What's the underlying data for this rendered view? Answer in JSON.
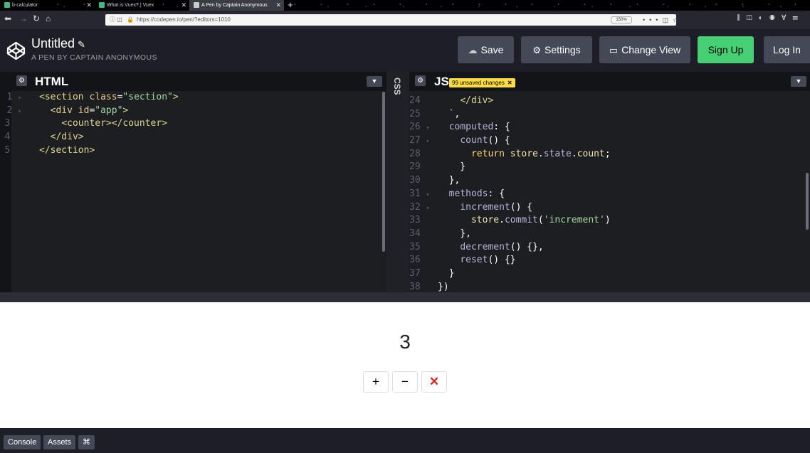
{
  "browser": {
    "tabs": [
      {
        "title": "b-calculator",
        "active": false,
        "favicon_color": "#41b883"
      },
      {
        "title": "What is Vuex? | Vuex",
        "active": false,
        "favicon_color": "#41b883"
      },
      {
        "title": "A Pen by Captain Anonymous",
        "active": true,
        "favicon_color": "#cccccc"
      }
    ],
    "new_tab": "+",
    "url": "https://codepen.io/pen/?editors=1010",
    "zoom": "150%"
  },
  "header": {
    "title": "Untitled",
    "subtitle": "A PEN BY CAPTAIN ANONYMOUS",
    "buttons": {
      "save": "Save",
      "settings": "Settings",
      "change_view": "Change View",
      "sign_up": "Sign Up",
      "log_in": "Log In"
    }
  },
  "editors": {
    "html": {
      "title": "HTML",
      "lines": [
        {
          "n": "1",
          "fold": true
        },
        {
          "n": "2",
          "fold": true
        },
        {
          "n": "3",
          "fold": false
        },
        {
          "n": "4",
          "fold": false
        },
        {
          "n": "5",
          "fold": false
        }
      ]
    },
    "css": {
      "title": "CSS"
    },
    "js": {
      "title": "JS",
      "badge": "99 unsaved changes",
      "lines": [
        {
          "n": "24",
          "fold": false
        },
        {
          "n": "25",
          "fold": false
        },
        {
          "n": "26",
          "fold": true
        },
        {
          "n": "27",
          "fold": true
        },
        {
          "n": "28",
          "fold": false
        },
        {
          "n": "29",
          "fold": false
        },
        {
          "n": "30",
          "fold": false
        },
        {
          "n": "31",
          "fold": true
        },
        {
          "n": "32",
          "fold": true
        },
        {
          "n": "33",
          "fold": false
        },
        {
          "n": "34",
          "fold": false
        },
        {
          "n": "35",
          "fold": false
        },
        {
          "n": "36",
          "fold": false
        },
        {
          "n": "37",
          "fold": false
        },
        {
          "n": "38",
          "fold": false
        }
      ]
    }
  },
  "preview": {
    "count": "3",
    "buttons": {
      "increment": "+",
      "decrement": "−",
      "reset": "✕"
    }
  },
  "footer": {
    "console": "Console",
    "assets": "Assets",
    "shortcuts": "⌘"
  }
}
